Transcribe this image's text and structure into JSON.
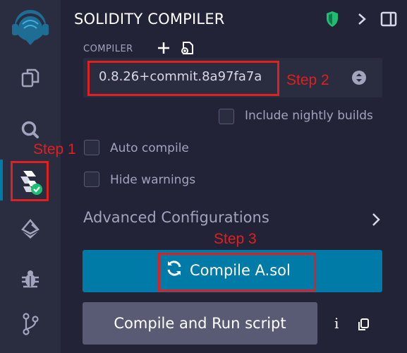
{
  "panel": {
    "title": "SOLIDITY COMPILER",
    "compiler_label": "COMPILER",
    "version": "0.8.26+commit.8a97fa7a",
    "nightly_label": "Include nightly builds",
    "auto_compile_label": "Auto compile",
    "hide_warnings_label": "Hide warnings",
    "advanced_label": "Advanced Configurations",
    "compile_button": "Compile A.sol",
    "compile_run_button": "Compile and Run script",
    "info_glyph": "i"
  },
  "annotations": {
    "step1": "Step 1",
    "step2": "Step 2",
    "step3": "Step 3"
  },
  "colors": {
    "annotation": "#e02020",
    "primary": "#007aa6",
    "secondary": "#595b75",
    "accent_green": "#1dbf73"
  },
  "icons": {
    "sidebar": [
      "remix-logo-icon",
      "file-explorer-icon",
      "search-icon",
      "solidity-compiler-icon",
      "deploy-run-icon",
      "debugger-icon",
      "git-icon"
    ],
    "header": [
      "shield-icon",
      "chevron-right-icon",
      "panel-toggle-icon"
    ]
  }
}
